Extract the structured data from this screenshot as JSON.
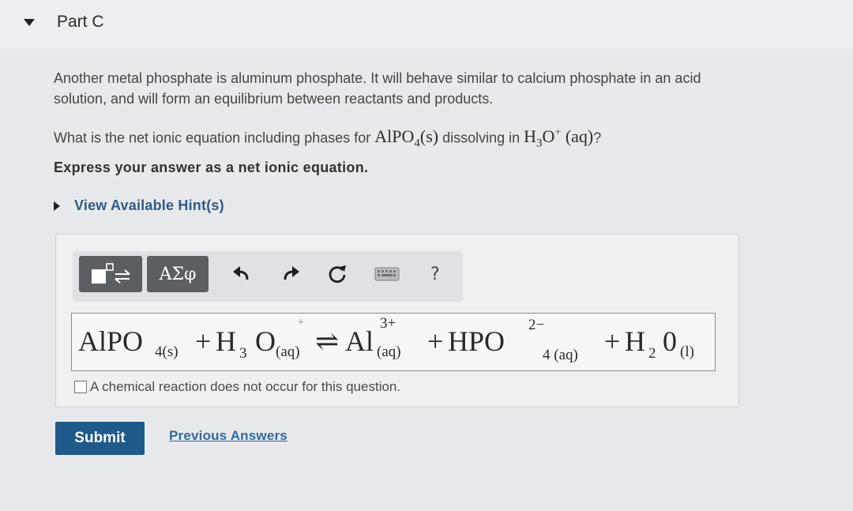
{
  "part": {
    "title": "Part C"
  },
  "question": {
    "intro_line1": "Another metal phosphate is aluminum phosphate. It will behave similar to calcium phosphate in an acid",
    "intro_line2": "solution, and will form an equilibrium between reactants and products.",
    "prompt_before": "What is the net ionic equation including phases for ",
    "compound1_main": "AlPO",
    "compound1_sub": "4",
    "compound1_phase": "(s)",
    "prompt_middle": " dissolving in ",
    "compound2_main": "H",
    "compound2_sub": "3",
    "compound2_o": "O",
    "compound2_sup": "+",
    "compound2_phase": "(aq)",
    "prompt_end": "?",
    "instruction": "Express your answer as a net ionic equation."
  },
  "hints": {
    "label": "View Available Hint(s)"
  },
  "toolbar": {
    "greek_label": "ΑΣφ",
    "help_label": "?"
  },
  "equation": {
    "alpo": "AlPO",
    "alpo_sub": "4(s)",
    "plus1": "+",
    "h_prefix": "H",
    "h3": "3",
    "o1": "O",
    "o1_sup": "+",
    "aq1": "(aq)",
    "arrow": "⇌",
    "al": "Al",
    "al_sup": "3+",
    "aq2": "(aq)",
    "plus2": "+",
    "hpo": "HPO",
    "hpo_sup": "2−",
    "hpo_sub": "4 (aq)",
    "plus3": "+",
    "h2_prefix": "H",
    "h2_sub": "2",
    "zero": "0",
    "liquid": "(l)"
  },
  "no_reaction": {
    "label": "A chemical reaction does not occur for this question."
  },
  "actions": {
    "submit_label": "Submit",
    "previous_answers_label": "Previous Answers"
  }
}
